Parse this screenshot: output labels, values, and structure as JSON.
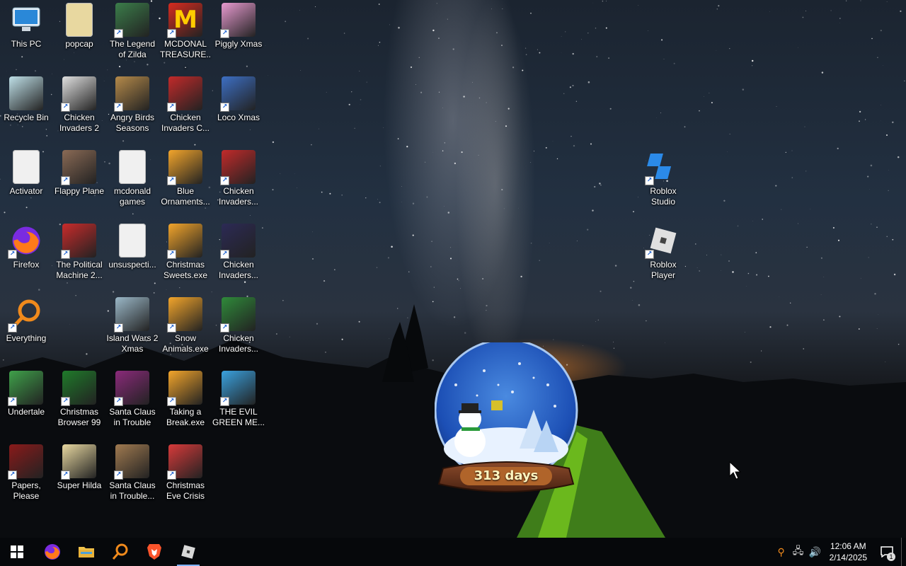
{
  "desktop": {
    "icons": [
      {
        "label": "This PC",
        "icon": "computer-icon",
        "color": "#4da3e8",
        "shortcut": false
      },
      {
        "label": "popcap",
        "icon": "folder-icon",
        "color": "#e8d8a0",
        "shortcut": false
      },
      {
        "label": "The Legend of Zilda",
        "icon": "game-icon",
        "color": "#3b7d4a",
        "shortcut": true
      },
      {
        "label": "MCDONAL TREASURE...",
        "icon": "mcdonalds-icon",
        "color": "#d62b1f",
        "shortcut": true
      },
      {
        "label": "Piggly Xmas",
        "icon": "pig-icon",
        "color": "#e89ad0",
        "shortcut": true
      },
      {
        "label": "Recycle Bin",
        "icon": "recycle-bin-icon",
        "color": "#bfe0e8",
        "shortcut": false
      },
      {
        "label": "Chicken Invaders 2",
        "icon": "chicken-icon",
        "color": "#e0e0e0",
        "shortcut": true
      },
      {
        "label": "Angry Birds Seasons",
        "icon": "angry-bird-icon",
        "color": "#b58a4a",
        "shortcut": true
      },
      {
        "label": "Chicken Invaders C...",
        "icon": "chicken-icon",
        "color": "#c22a2a",
        "shortcut": true
      },
      {
        "label": "Loco Xmas",
        "icon": "bear-icon",
        "color": "#3d6fc4",
        "shortcut": true
      },
      {
        "label": "Activator",
        "icon": "file-icon",
        "color": "#f0f0f0",
        "shortcut": false
      },
      {
        "label": "Flappy Plane",
        "icon": "plane-icon",
        "color": "#8a6a55",
        "shortcut": true
      },
      {
        "label": "mcdonald games",
        "icon": "folder-icon",
        "color": "#f0f0f0",
        "shortcut": false
      },
      {
        "label": "Blue Ornaments...",
        "icon": "exe-icon",
        "color": "#f3a52b",
        "shortcut": true
      },
      {
        "label": "Chicken Invaders...",
        "icon": "chicken-icon",
        "color": "#c22a2a",
        "shortcut": true
      },
      {
        "label": "Firefox",
        "icon": "firefox-icon",
        "color": "#ff7a1a",
        "shortcut": true
      },
      {
        "label": "The Political Machine 2...",
        "icon": "politics-icon",
        "color": "#c92b2b",
        "shortcut": true
      },
      {
        "label": "unsuspecti...",
        "icon": "file-icon",
        "color": "#f0f0f0",
        "shortcut": false
      },
      {
        "label": "Christmas Sweets.exe",
        "icon": "exe-icon",
        "color": "#f3a52b",
        "shortcut": true
      },
      {
        "label": "Chicken Invaders...",
        "icon": "chicken-icon",
        "color": "#2c2a55",
        "shortcut": true
      },
      {
        "label": "Everything",
        "icon": "search-icon",
        "color": "#f08a1c",
        "shortcut": true
      },
      {
        "label": "",
        "icon": "",
        "color": "",
        "shortcut": false
      },
      {
        "label": "Island Wars 2 Xmas",
        "icon": "island-icon",
        "color": "#9bb8c8",
        "shortcut": true
      },
      {
        "label": "Snow Animals.exe",
        "icon": "exe-icon",
        "color": "#f3a52b",
        "shortcut": true
      },
      {
        "label": "Chicken Invaders...",
        "icon": "chicken-icon",
        "color": "#2f8a3a",
        "shortcut": true
      },
      {
        "label": "Undertale",
        "icon": "undertale-icon",
        "color": "#3fa14a",
        "shortcut": true
      },
      {
        "label": "Christmas Browser 99",
        "icon": "tree-icon",
        "color": "#1f7a2a",
        "shortcut": true
      },
      {
        "label": "Santa Claus in Trouble",
        "icon": "santa-icon",
        "color": "#8a2a7a",
        "shortcut": true
      },
      {
        "label": "Taking a Break.exe",
        "icon": "exe-icon",
        "color": "#f3a52b",
        "shortcut": true
      },
      {
        "label": "THE EVIL GREEN ME...",
        "icon": "messenger-icon",
        "color": "#3aa2e0",
        "shortcut": true
      },
      {
        "label": "Papers, Please",
        "icon": "papers-icon",
        "color": "#8a1a1a",
        "shortcut": true
      },
      {
        "label": "Super Hilda",
        "icon": "hilda-icon",
        "color": "#e8d8a0",
        "shortcut": true
      },
      {
        "label": "Santa Claus in Trouble...",
        "icon": "santa-icon",
        "color": "#a07a50",
        "shortcut": true
      },
      {
        "label": "Christmas Eve Crisis",
        "icon": "santa-face-icon",
        "color": "#d83a3a",
        "shortcut": true
      }
    ],
    "right_icons": [
      {
        "label": "Roblox Studio",
        "icon": "roblox-studio-icon",
        "color": "#2b8ae8",
        "shortcut": true
      },
      {
        "label": "Roblox Player",
        "icon": "roblox-icon",
        "color": "#e0e0e0",
        "shortcut": true
      }
    ],
    "globe_text": "313 days"
  },
  "taskbar": {
    "start": "start-icon",
    "apps": [
      {
        "name": "firefox",
        "icon": "firefox-icon"
      },
      {
        "name": "file-explorer",
        "icon": "folder-icon"
      },
      {
        "name": "everything",
        "icon": "search-icon"
      },
      {
        "name": "brave",
        "icon": "brave-icon"
      },
      {
        "name": "roblox",
        "icon": "roblox-icon",
        "active": true
      }
    ],
    "time": "12:06 AM",
    "date": "2/14/2025",
    "notification_count": "1"
  }
}
